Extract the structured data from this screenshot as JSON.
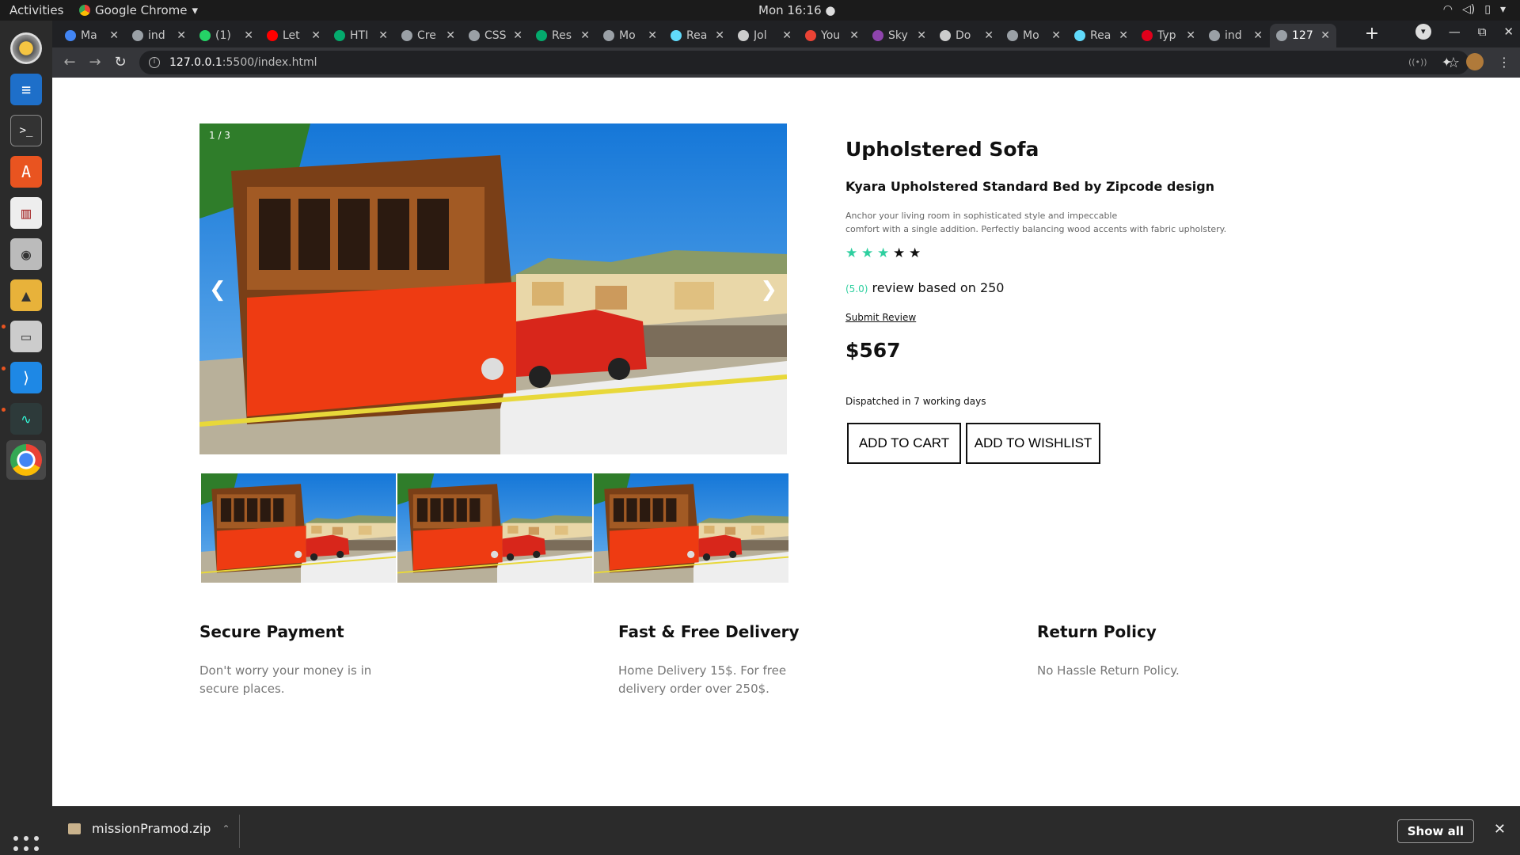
{
  "topbar": {
    "activities": "Activities",
    "app_name": "Google Chrome",
    "clock": "Mon 16:16"
  },
  "dock": {
    "items": [
      "rhythmbox-icon",
      "writer-icon",
      "terminal-icon",
      "software-center-icon",
      "ebook-reader-icon",
      "camera-icon",
      "image-viewer-icon",
      "files-icon",
      "vscode-icon",
      "system-monitor-icon",
      "chrome-icon"
    ]
  },
  "tabs": [
    {
      "label": "Ma",
      "color": "#4285f4"
    },
    {
      "label": "ind",
      "color": "#9aa0a6"
    },
    {
      "label": "(1)",
      "color": "#25d366"
    },
    {
      "label": "Let",
      "color": "#ff0000"
    },
    {
      "label": "HTI",
      "color": "#04aa6d"
    },
    {
      "label": "Cre",
      "color": "#9aa0a6"
    },
    {
      "label": "CSS",
      "color": "#9aa0a6"
    },
    {
      "label": "Res",
      "color": "#04aa6d"
    },
    {
      "label": "Mo",
      "color": "#9aa0a6"
    },
    {
      "label": "Rea",
      "color": "#61dafb"
    },
    {
      "label": "Jol",
      "color": "#cccccc"
    },
    {
      "label": "You",
      "color": "#ea4335"
    },
    {
      "label": "Sky",
      "color": "#8e44ad"
    },
    {
      "label": "Do",
      "color": "#cccccc"
    },
    {
      "label": "Mo",
      "color": "#9aa0a6"
    },
    {
      "label": "Rea",
      "color": "#61dafb"
    },
    {
      "label": "Typ",
      "color": "#e0001b"
    },
    {
      "label": "ind",
      "color": "#9aa0a6"
    },
    {
      "label": "127",
      "color": "#9aa0a6",
      "active": true
    }
  ],
  "address": {
    "host": "127.0.0.1",
    "path": ":5500/index.html"
  },
  "product": {
    "slide_counter": "1 / 3",
    "prev": "❮",
    "next": "❯",
    "title": "Upholstered Sofa",
    "subtitle": "Kyara Upholstered Standard Bed by Zipcode design",
    "description_line1": "Anchor your living room in sophisticated style and impeccable",
    "description_line2": "comfort with a single addition. Perfectly balancing wood accents with fabric upholstery.",
    "rating_filled": 3,
    "rating_total": 5,
    "star_color_filled": "#2ecf9f",
    "star_color_empty": "#111111",
    "review_score": "(5.0)",
    "review_text": " review based on 250",
    "submit_review": "Submit Review",
    "price": "$567",
    "dispatch": "Dispatched in 7 working days",
    "add_to_cart": "ADD TO CART",
    "add_to_wishlist": "ADD TO WISHLIST"
  },
  "features": [
    {
      "title": "Secure Payment",
      "text": "Don't worry your money is in secure places."
    },
    {
      "title": "Fast & Free Delivery",
      "text": "Home Delivery 15$. For free delivery order over 250$."
    },
    {
      "title": "Return Policy",
      "text": "No Hassle Return Policy."
    }
  ],
  "downloads": {
    "file": "missionPramod.zip",
    "show_all": "Show all"
  }
}
